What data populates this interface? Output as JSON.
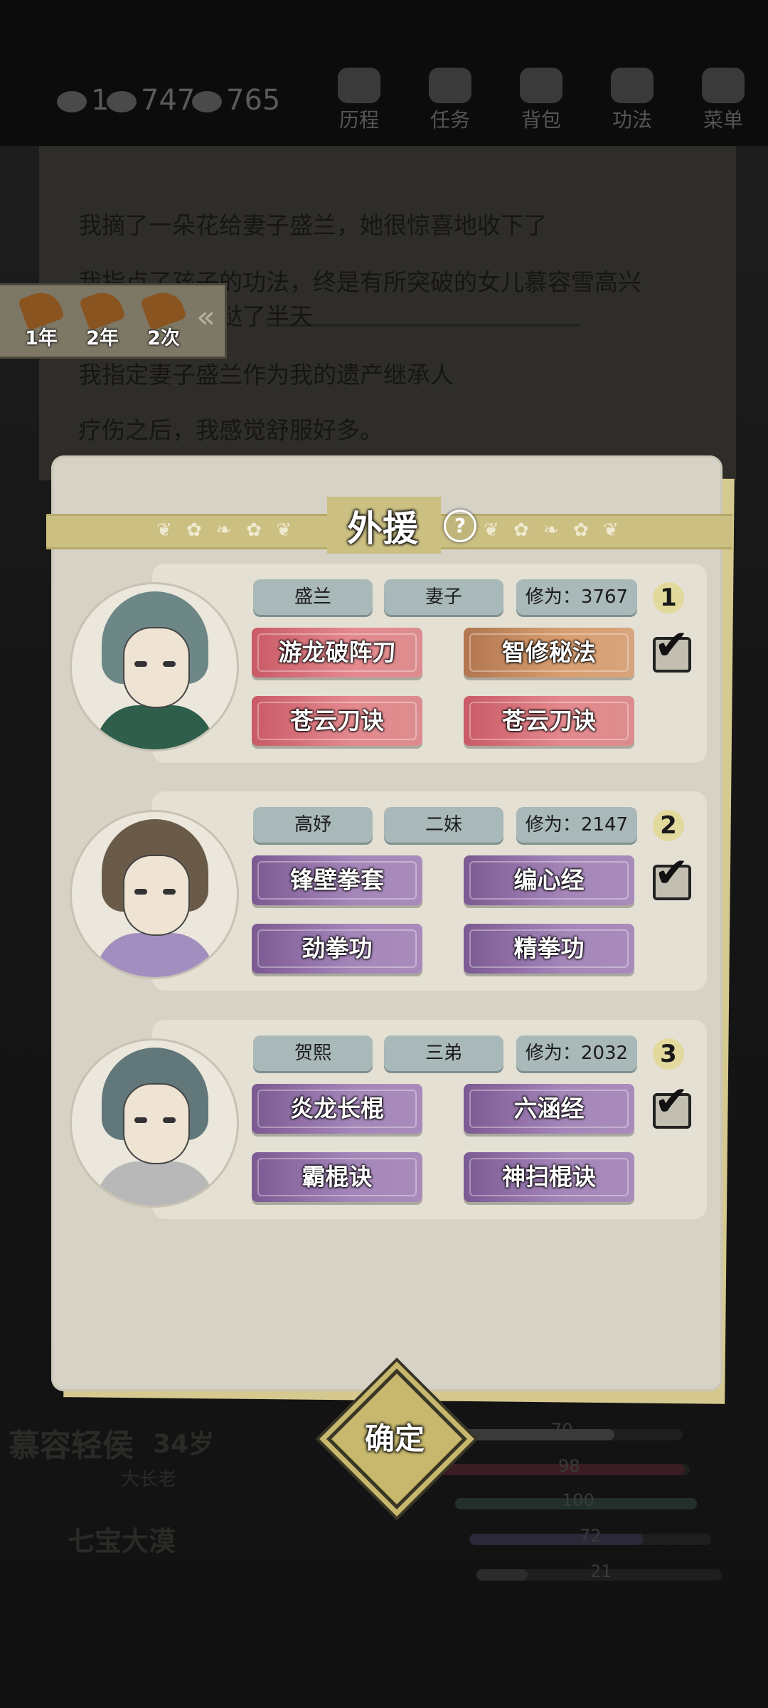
{
  "topbar": {
    "resources": [
      "1",
      "747",
      "765"
    ],
    "menu": [
      {
        "label": "历程",
        "icon": "journey-icon"
      },
      {
        "label": "任务",
        "icon": "task-scroll-icon"
      },
      {
        "label": "背包",
        "icon": "bag-icon"
      },
      {
        "label": "功法",
        "icon": "manual-book-icon"
      },
      {
        "label": "菜单",
        "icon": "fan-menu-icon"
      }
    ]
  },
  "story": {
    "lines": [
      "我摘了一朵花给妻子盛兰，她很惊喜地收下了",
      "我指点了孩子的功法，终是有所突破的女儿慕容雪高兴",
      "蹦跶了半天",
      "我指定妻子盛兰作为我的遗产继承人",
      "疗伤之后，我感觉舒服好多。"
    ]
  },
  "time_skip": {
    "buttons": [
      "1年",
      "2年",
      "2次"
    ]
  },
  "background_character": {
    "name": "慕容轻侯",
    "age": "34岁",
    "title": "大长老",
    "location": "七宝大漠",
    "stat_values": [
      "70",
      "98",
      "100",
      "72",
      "21"
    ]
  },
  "dialog": {
    "title": "外援",
    "help_symbol": "?",
    "helpers": [
      {
        "index": "1",
        "name": "盛兰",
        "relation": "妻子",
        "cultivation": "修为：3767",
        "checked": true,
        "skills": [
          "游龙破阵刀",
          "智修秘法",
          "苍云刀诀",
          "苍云刀诀"
        ],
        "skill_colors": [
          "red",
          "orange",
          "red",
          "red"
        ]
      },
      {
        "index": "2",
        "name": "高妤",
        "relation": "二妹",
        "cultivation": "修为：2147",
        "checked": true,
        "skills": [
          "锋壁拳套",
          "编心经",
          "劲拳功",
          "精拳功"
        ],
        "skill_colors": [
          "purple",
          "purple",
          "purple",
          "purple"
        ]
      },
      {
        "index": "3",
        "name": "贺熙",
        "relation": "三弟",
        "cultivation": "修为：2032",
        "checked": true,
        "skills": [
          "炎龙长棍",
          "六涵经",
          "霸棍诀",
          "神扫棍诀"
        ],
        "skill_colors": [
          "purple",
          "purple",
          "purple",
          "purple"
        ]
      }
    ],
    "confirm_label": "确定"
  },
  "colors": {
    "dialog_bg": "#d6d2c5",
    "ribbon": "#cbbf82",
    "tag": "#a9b8b8",
    "skill_red": "#d9757d",
    "skill_orange": "#c98c62",
    "skill_purple": "#9171a8"
  }
}
